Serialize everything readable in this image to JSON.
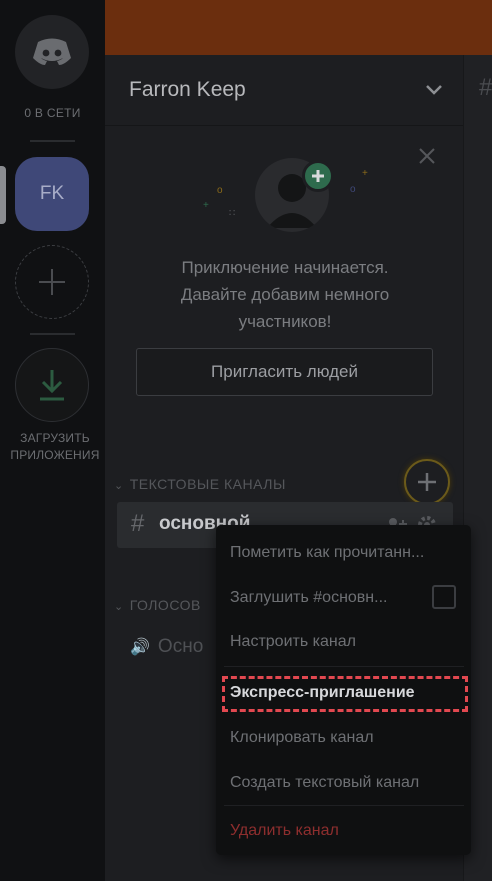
{
  "rail": {
    "online_label": "0 В СЕТИ",
    "server_initials": "FK",
    "download_label_line1": "ЗАГРУЗИТЬ",
    "download_label_line2": "ПРИЛОЖЕНИЯ"
  },
  "server": {
    "name": "Farron Keep"
  },
  "invite_panel": {
    "line1": "Приключение начинается.",
    "line2": "Давайте добавим немного",
    "line3": "участников!",
    "button_label": "Пригласить людей"
  },
  "channels": {
    "text_category": "ТЕКСТОВЫЕ КАНАЛЫ",
    "text_channel_name": "основной",
    "voice_category_partial": "ГОЛОСОВ",
    "voice_channel_partial": "Осно"
  },
  "context_menu": {
    "items": [
      "Пометить как прочитанн...",
      "Заглушить #основн...",
      "Настроить канал",
      "Экспресс-приглашение",
      "Клонировать канал",
      "Создать текстовый канал",
      "Удалить канал"
    ]
  },
  "colors": {
    "top_bar": "#6b2e0e",
    "highlight_border": "#e24850",
    "delete_text": "#8e2e2e"
  }
}
